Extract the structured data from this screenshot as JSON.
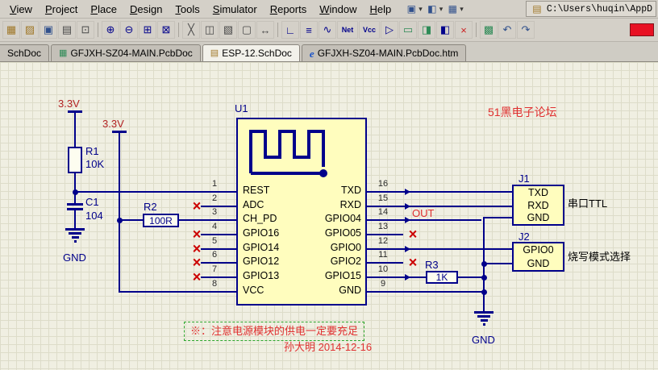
{
  "window": {
    "path_display": "C:\\Users\\huqin\\AppD",
    "path_icon": "▤"
  },
  "menu": {
    "items": [
      {
        "label": "View"
      },
      {
        "label": "Project"
      },
      {
        "label": "Place"
      },
      {
        "label": "Design"
      },
      {
        "label": "Tools"
      },
      {
        "label": "Simulator"
      },
      {
        "label": "Reports"
      },
      {
        "label": "Window"
      },
      {
        "label": "Help"
      }
    ],
    "caret": "▾",
    "right_icons": [
      {
        "name": "panels-dropdown-icon",
        "glyph": "▣"
      },
      {
        "name": "alignment-dropdown-icon",
        "glyph": "◧"
      },
      {
        "name": "grid-dropdown-icon",
        "glyph": "▦"
      }
    ]
  },
  "toolbar": {
    "icons": [
      {
        "name": "sheet-stub-icon",
        "glyph": "▦"
      },
      {
        "name": "open-document-icon",
        "glyph": "▨"
      },
      {
        "name": "save-document-icon",
        "glyph": "▣"
      },
      {
        "name": "print-icon",
        "glyph": "▤"
      },
      {
        "name": "print-preview-icon",
        "glyph": "⊡"
      },
      {
        "name": "zoom-in-icon",
        "glyph": "⊕"
      },
      {
        "name": "zoom-out-icon",
        "glyph": "⊖"
      },
      {
        "name": "zoom-area-icon",
        "glyph": "⊞"
      },
      {
        "name": "zoom-all-icon",
        "glyph": "⊠"
      },
      {
        "name": "cut-icon",
        "glyph": "╳"
      },
      {
        "name": "copy-icon",
        "glyph": "◫"
      },
      {
        "name": "paste-icon",
        "glyph": "▧"
      },
      {
        "name": "select-area-icon",
        "glyph": "▢"
      },
      {
        "name": "move-object-icon",
        "glyph": "↔"
      },
      {
        "name": "wire-tool-icon",
        "glyph": "∟"
      },
      {
        "name": "bus-tool-icon",
        "glyph": "≡"
      },
      {
        "name": "harness-tool-icon",
        "glyph": "∿"
      },
      {
        "name": "net-label-tool-icon",
        "glyph": "Net"
      },
      {
        "name": "power-port-tool-icon",
        "glyph": "Vcc"
      },
      {
        "name": "place-part-icon",
        "glyph": "▷"
      },
      {
        "name": "sheet-symbol-icon",
        "glyph": "▭"
      },
      {
        "name": "sheet-entry-icon",
        "glyph": "◨"
      },
      {
        "name": "port-tool-icon",
        "glyph": "◧"
      },
      {
        "name": "no-erc-tool-icon",
        "glyph": "×"
      },
      {
        "name": "paste-array-icon",
        "glyph": "▩"
      },
      {
        "name": "undo-icon",
        "glyph": "↶"
      },
      {
        "name": "redo-icon",
        "glyph": "↷"
      }
    ]
  },
  "tabs": [
    {
      "label": "SchDoc"
    },
    {
      "label": "GFJXH-SZ04-MAIN.PcbDoc"
    },
    {
      "label": "ESP-12.SchDoc"
    },
    {
      "label": "GFJXH-SZ04-MAIN.PcbDoc.htm"
    }
  ],
  "schematic": {
    "power": {
      "rail1": "3.3V",
      "rail2": "3.3V",
      "gnd_left": "GND",
      "gnd_right": "GND"
    },
    "r1": {
      "ref": "R1",
      "value": "10K"
    },
    "c1": {
      "ref": "C1",
      "value": "104"
    },
    "r2": {
      "ref": "R2",
      "value": "100R"
    },
    "r3": {
      "ref": "R3",
      "value": "1K"
    },
    "u1": {
      "ref": "U1",
      "left_pins": [
        {
          "num": "1",
          "name": "REST"
        },
        {
          "num": "2",
          "name": "ADC"
        },
        {
          "num": "3",
          "name": "CH_PD"
        },
        {
          "num": "4",
          "name": "GPIO16"
        },
        {
          "num": "5",
          "name": "GPIO14"
        },
        {
          "num": "6",
          "name": "GPIO12"
        },
        {
          "num": "7",
          "name": "GPIO13"
        },
        {
          "num": "8",
          "name": "VCC"
        }
      ],
      "right_pins": [
        {
          "num": "16",
          "name": "TXD"
        },
        {
          "num": "15",
          "name": "RXD"
        },
        {
          "num": "14",
          "name": "GPIO04"
        },
        {
          "num": "13",
          "name": "GPIO05"
        },
        {
          "num": "12",
          "name": "GPIO0"
        },
        {
          "num": "11",
          "name": "GPIO2"
        },
        {
          "num": "10",
          "name": "GPIO15"
        },
        {
          "num": "9",
          "name": "GND"
        }
      ]
    },
    "j1": {
      "ref": "J1",
      "rows": [
        "TXD",
        "RXD",
        "GND"
      ],
      "caption": "串口TTL"
    },
    "j2": {
      "ref": "J2",
      "rows": [
        "GPIO0",
        "GND"
      ],
      "caption": "烧写模式选择"
    },
    "net_label_out": "OUT",
    "noerc_glyph": "×",
    "forum_watermark": "51黑电子论坛",
    "note": "※：注意电源模块的供电一定要充足",
    "signature": "孙大明 2014-12-16"
  },
  "colors": {
    "wire": "#00008B",
    "component_fill": "#FFFDBE",
    "canvas": "#F0EFE2",
    "annotation_red": "#E03030",
    "note_border_green": "#2EA82E",
    "power_label": "#B22222"
  }
}
